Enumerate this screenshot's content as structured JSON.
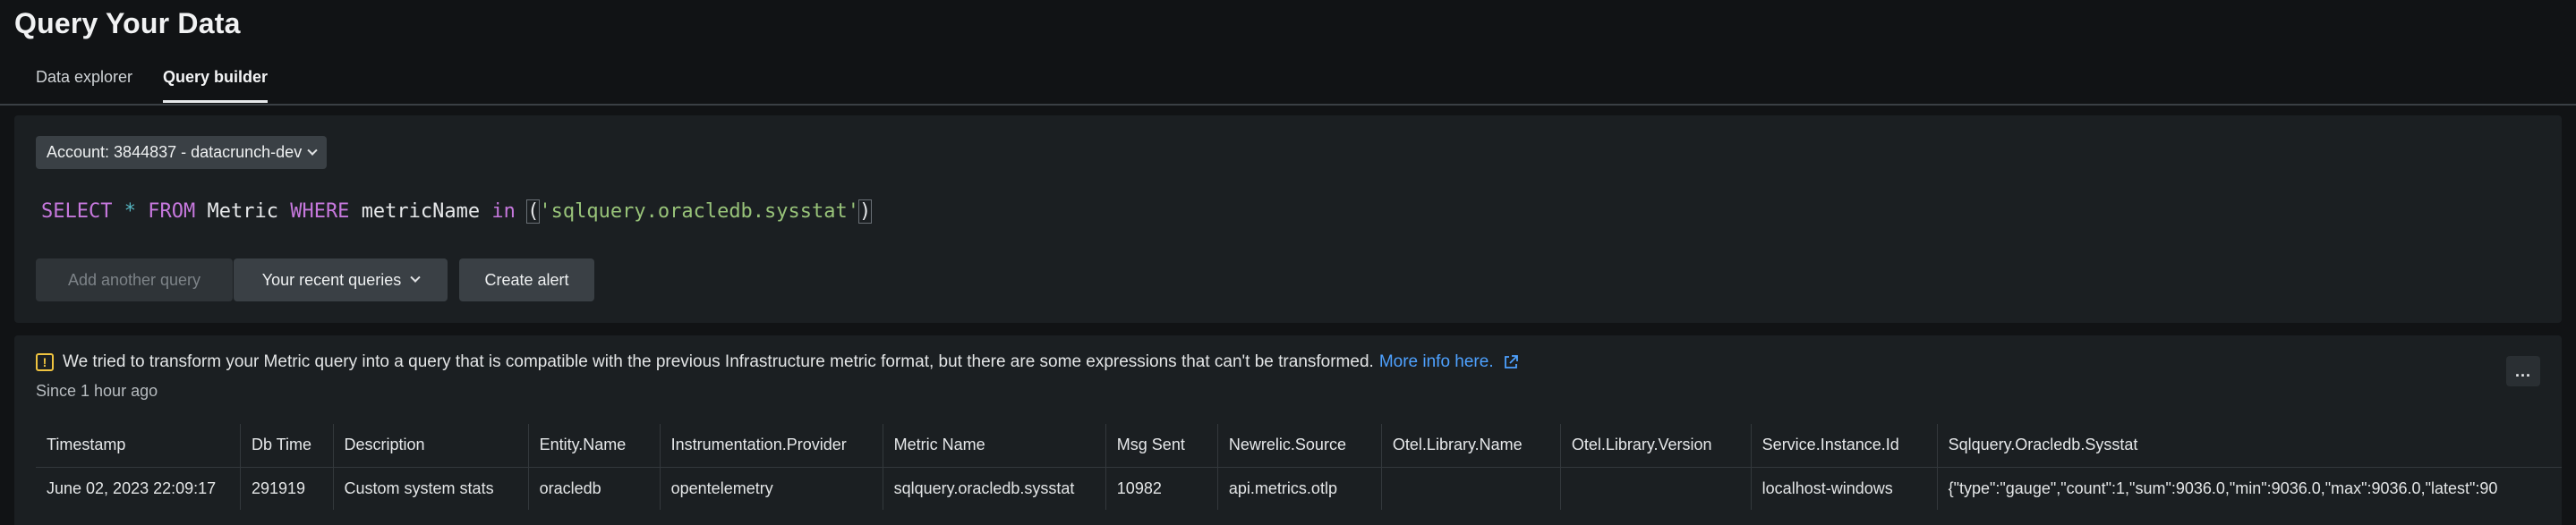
{
  "page": {
    "title": "Query Your Data"
  },
  "tabs": [
    {
      "label": "Data explorer"
    },
    {
      "label": "Query builder",
      "active": true
    }
  ],
  "query": {
    "account_label": "Account: 3844837 - datacrunch-dev",
    "nrql": {
      "select": "SELECT",
      "star": "*",
      "from": "FROM",
      "table": "Metric",
      "where": "WHERE",
      "field": "metricName",
      "in": "in",
      "open_paren": "(",
      "value": "'sqlquery.oracledb.sysstat'",
      "close_paren": ")"
    },
    "buttons": {
      "add_query": "Add another query",
      "recent": "Your recent queries",
      "alert": "Create alert"
    }
  },
  "results": {
    "warning_text": "We tried to transform your Metric query into a query that is compatible with the previous Infrastructure metric format, but there are some expressions that can't be transformed.",
    "more_info": "More info here.",
    "since": "Since 1 hour ago",
    "menu_label": "...",
    "columns": [
      "Timestamp",
      "Db Time",
      "Description",
      "Entity.Name",
      "Instrumentation.Provider",
      "Metric Name",
      "Msg Sent",
      "Newrelic.Source",
      "Otel.Library.Name",
      "Otel.Library.Version",
      "Service.Instance.Id",
      "Sqlquery.Oracledb.Sysstat"
    ],
    "rows": [
      [
        "June 02, 2023 22:09:17",
        "291919",
        "Custom system stats",
        "oracledb",
        "opentelemetry",
        "sqlquery.oracledb.sysstat",
        "10982",
        "api.metrics.otlp",
        "",
        "",
        "localhost-windows",
        "{\"type\":\"gauge\",\"count\":1,\"sum\":9036.0,\"min\":9036.0,\"max\":9036.0,\"latest\":90"
      ]
    ]
  },
  "colors": {
    "background": "#111315",
    "panel": "#1b1f22",
    "keyword": "#c678dd",
    "string": "#98c379",
    "link": "#4ea1ff",
    "warning": "#f0c440"
  }
}
